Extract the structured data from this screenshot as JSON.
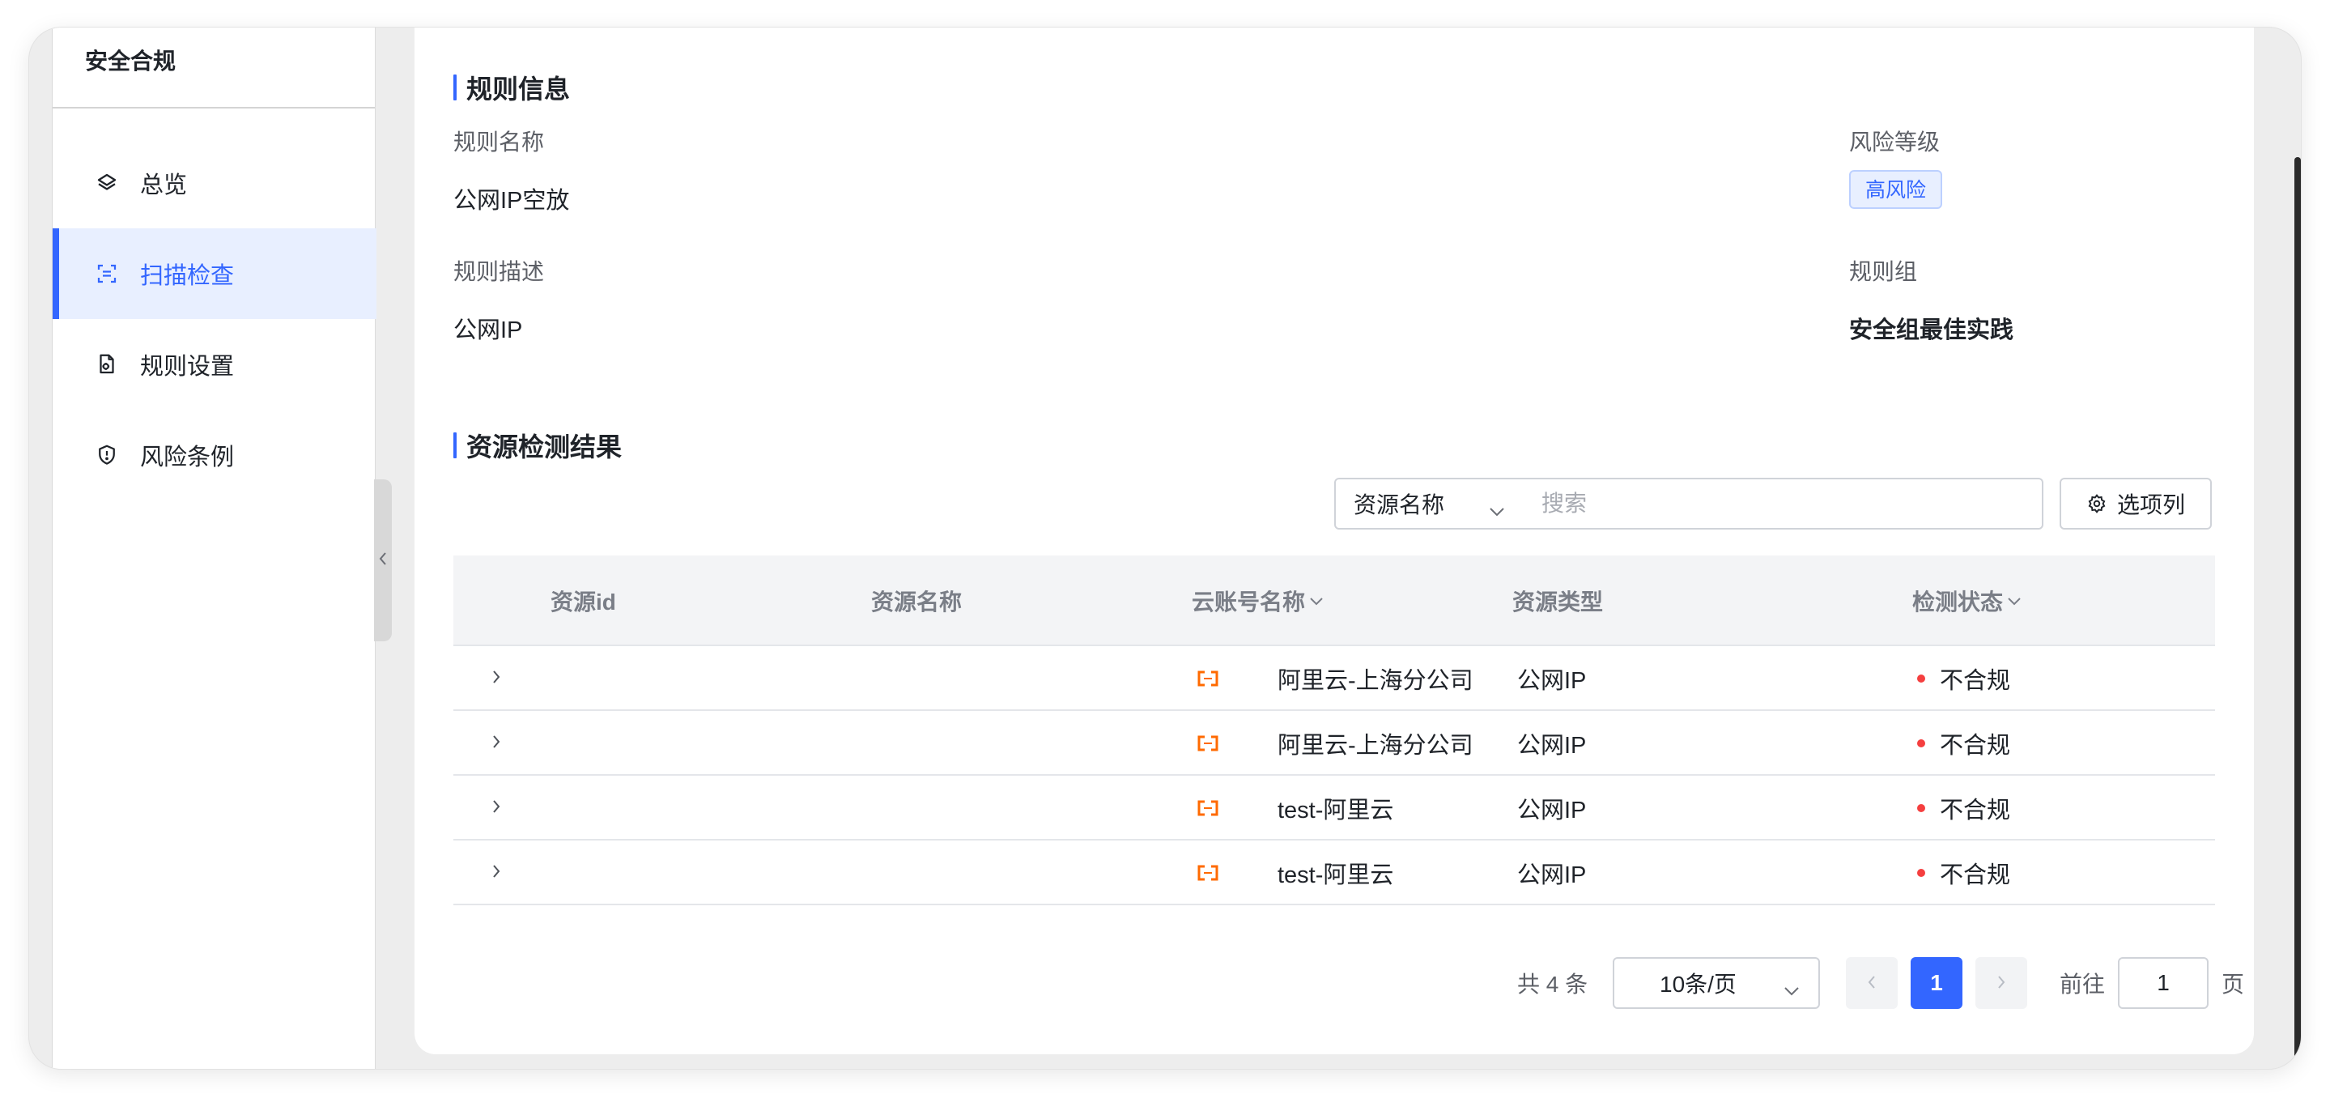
{
  "sidebar": {
    "title": "安全合规",
    "items": [
      {
        "label": "总览",
        "icon": "layers-icon"
      },
      {
        "label": "扫描检查",
        "icon": "scan-icon",
        "active": true
      },
      {
        "label": "规则设置",
        "icon": "document-settings-icon"
      },
      {
        "label": "风险条例",
        "icon": "shield-alert-icon"
      }
    ]
  },
  "rule_info": {
    "title": "规则信息",
    "name_label": "规则名称",
    "name_value": "公网IP空放",
    "risk_label": "风险等级",
    "risk_value": "高风险",
    "desc_label": "规则描述",
    "desc_value": "公网IP",
    "group_label": "规则组",
    "group_value": "安全组最佳实践"
  },
  "results": {
    "title": "资源检测结果",
    "search_field": "资源名称",
    "search_placeholder": "搜索",
    "columns_button": "选项列",
    "headers": {
      "resource_id": "资源id",
      "resource_name": "资源名称",
      "account": "云账号名称",
      "resource_type": "资源类型",
      "status": "检测状态"
    },
    "rows": [
      {
        "account": "阿里云-上海分公司",
        "type": "公网IP",
        "status": "不合规"
      },
      {
        "account": "阿里云-上海分公司",
        "type": "公网IP",
        "status": "不合规"
      },
      {
        "account": "test-阿里云",
        "type": "公网IP",
        "status": "不合规"
      },
      {
        "account": "test-阿里云",
        "type": "公网IP",
        "status": "不合规"
      }
    ]
  },
  "pagination": {
    "total": "共 4 条",
    "page_size": "10条/页",
    "current_page": "1",
    "goto_label": "前往",
    "goto_value": "1",
    "page_suffix": "页"
  },
  "colors": {
    "accent": "#3366ff",
    "status_noncompliant": "#f53f3f",
    "aliyun_orange": "#ff6a00"
  }
}
